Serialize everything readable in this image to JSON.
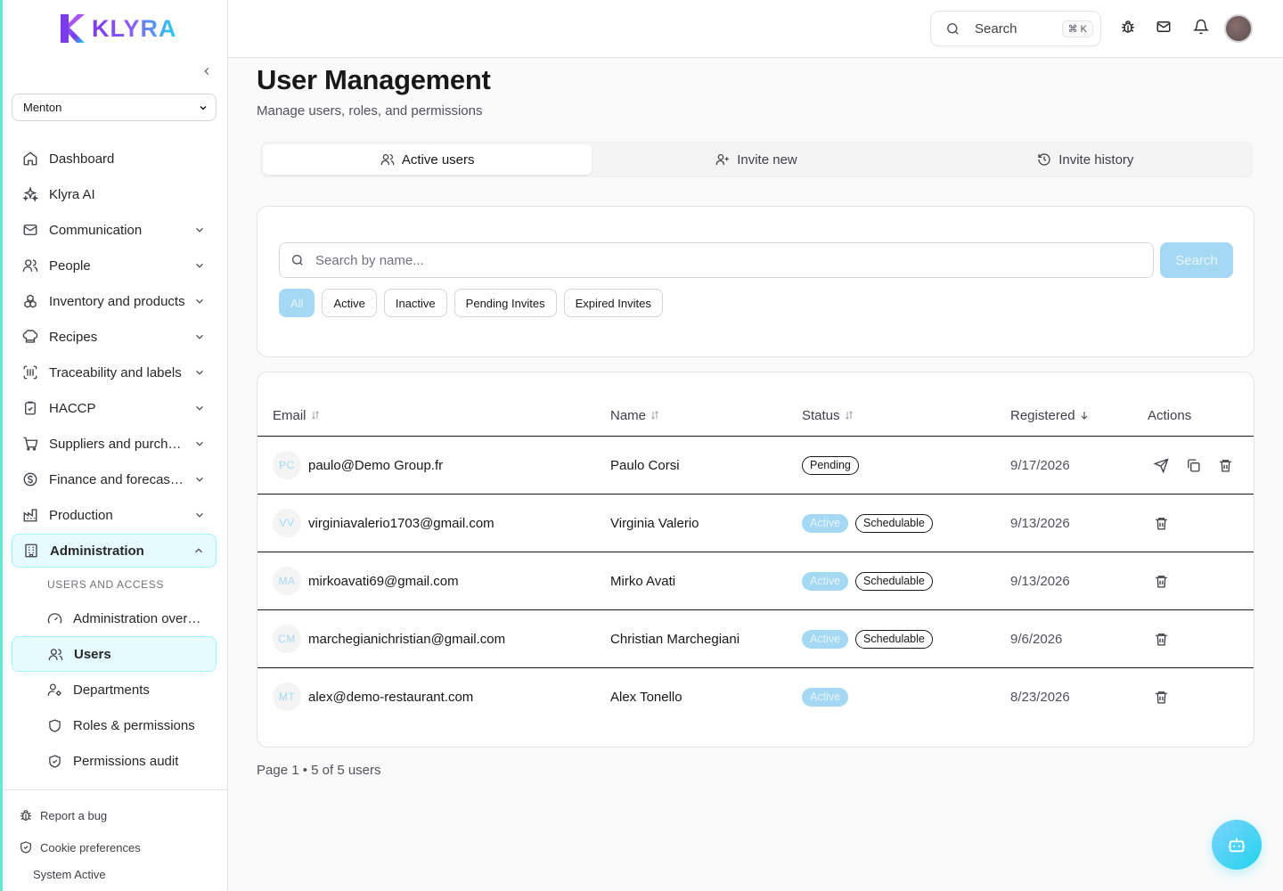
{
  "brand": {
    "name": "KLYRA"
  },
  "sidebar": {
    "workspace": "Menton",
    "items": [
      {
        "label": "Dashboard",
        "icon": "home-icon",
        "expandable": false
      },
      {
        "label": "Klyra AI",
        "icon": "sparkles-icon",
        "expandable": false
      },
      {
        "label": "Communication",
        "icon": "mail-icon",
        "expandable": true
      },
      {
        "label": "People",
        "icon": "users-icon",
        "expandable": true
      },
      {
        "label": "Inventory and products",
        "icon": "boxes-icon",
        "expandable": true
      },
      {
        "label": "Recipes",
        "icon": "chef-hat-icon",
        "expandable": true
      },
      {
        "label": "Traceability and labels",
        "icon": "barcode-scan-icon",
        "expandable": true
      },
      {
        "label": "HACCP",
        "icon": "clipboard-check-icon",
        "expandable": true
      },
      {
        "label": "Suppliers and purchasing",
        "icon": "cart-icon",
        "expandable": true
      },
      {
        "label": "Finance and forecasting",
        "icon": "dollar-circle-icon",
        "expandable": true
      },
      {
        "label": "Production",
        "icon": "factory-icon",
        "expandable": true
      },
      {
        "label": "Administration",
        "icon": "building-icon",
        "expandable": true,
        "expanded": true
      }
    ],
    "section_label": "USERS AND ACCESS",
    "sub_items": [
      {
        "label": "Administration overview",
        "icon": "gauge-icon"
      },
      {
        "label": "Users",
        "icon": "users-icon",
        "active": true
      },
      {
        "label": "Departments",
        "icon": "user-cog-icon"
      },
      {
        "label": "Roles & permissions",
        "icon": "shield-icon"
      },
      {
        "label": "Permissions audit",
        "icon": "shield-check-icon"
      }
    ],
    "footer": {
      "report_bug": "Report a bug",
      "cookie_prefs": "Cookie preferences",
      "system_status": "System Active"
    }
  },
  "topbar": {
    "search_label": "Search",
    "search_shortcut": "⌘ K"
  },
  "page": {
    "title": "User Management",
    "subtitle": "Manage users, roles, and permissions"
  },
  "tabs": [
    {
      "label": "Active users",
      "icon": "users-icon",
      "active": true
    },
    {
      "label": "Invite new",
      "icon": "user-plus-icon",
      "active": false
    },
    {
      "label": "Invite history",
      "icon": "history-icon",
      "active": false
    }
  ],
  "filters": {
    "search_placeholder": "Search by name...",
    "search_button": "Search",
    "chips": [
      "All",
      "Active",
      "Inactive",
      "Pending Invites",
      "Expired Invites"
    ],
    "selected_chip": "All"
  },
  "table": {
    "columns": [
      "Email",
      "Name",
      "Status",
      "Registered",
      "Actions"
    ],
    "sorted_column": "Registered",
    "rows": [
      {
        "initials": "PC",
        "email": "paulo@Demo Group.fr",
        "name": "Paulo Corsi",
        "status": "Pending",
        "tags": [],
        "registered": "9/17/2026",
        "actions": [
          "send-icon",
          "copy-icon",
          "trash-icon"
        ]
      },
      {
        "initials": "VV",
        "email": "virginiavalerio1703@gmail.com",
        "name": "Virginia Valerio",
        "status": "Active",
        "tags": [
          "Schedulable"
        ],
        "registered": "9/13/2026",
        "actions": [
          "trash-icon"
        ]
      },
      {
        "initials": "MA",
        "email": "mirkoavati69@gmail.com",
        "name": "Mirko Avati",
        "status": "Active",
        "tags": [
          "Schedulable"
        ],
        "registered": "9/13/2026",
        "actions": [
          "trash-icon"
        ]
      },
      {
        "initials": "CM",
        "email": "marchegianichristian@gmail.com",
        "name": "Christian Marchegiani",
        "status": "Active",
        "tags": [
          "Schedulable"
        ],
        "registered": "9/6/2026",
        "actions": [
          "trash-icon"
        ]
      },
      {
        "initials": "MT",
        "email": "alex@demo-restaurant.com",
        "name": "Alex Tonello",
        "status": "Active",
        "tags": [],
        "registered": "8/23/2026",
        "actions": [
          "trash-icon"
        ]
      }
    ]
  },
  "pagination": {
    "text": "Page 1 • 5 of 5 users"
  },
  "colors": {
    "accent": "#22d3ee",
    "accent_soft": "#a5d8f3",
    "active_nav_bg": "#e6fbfd"
  }
}
